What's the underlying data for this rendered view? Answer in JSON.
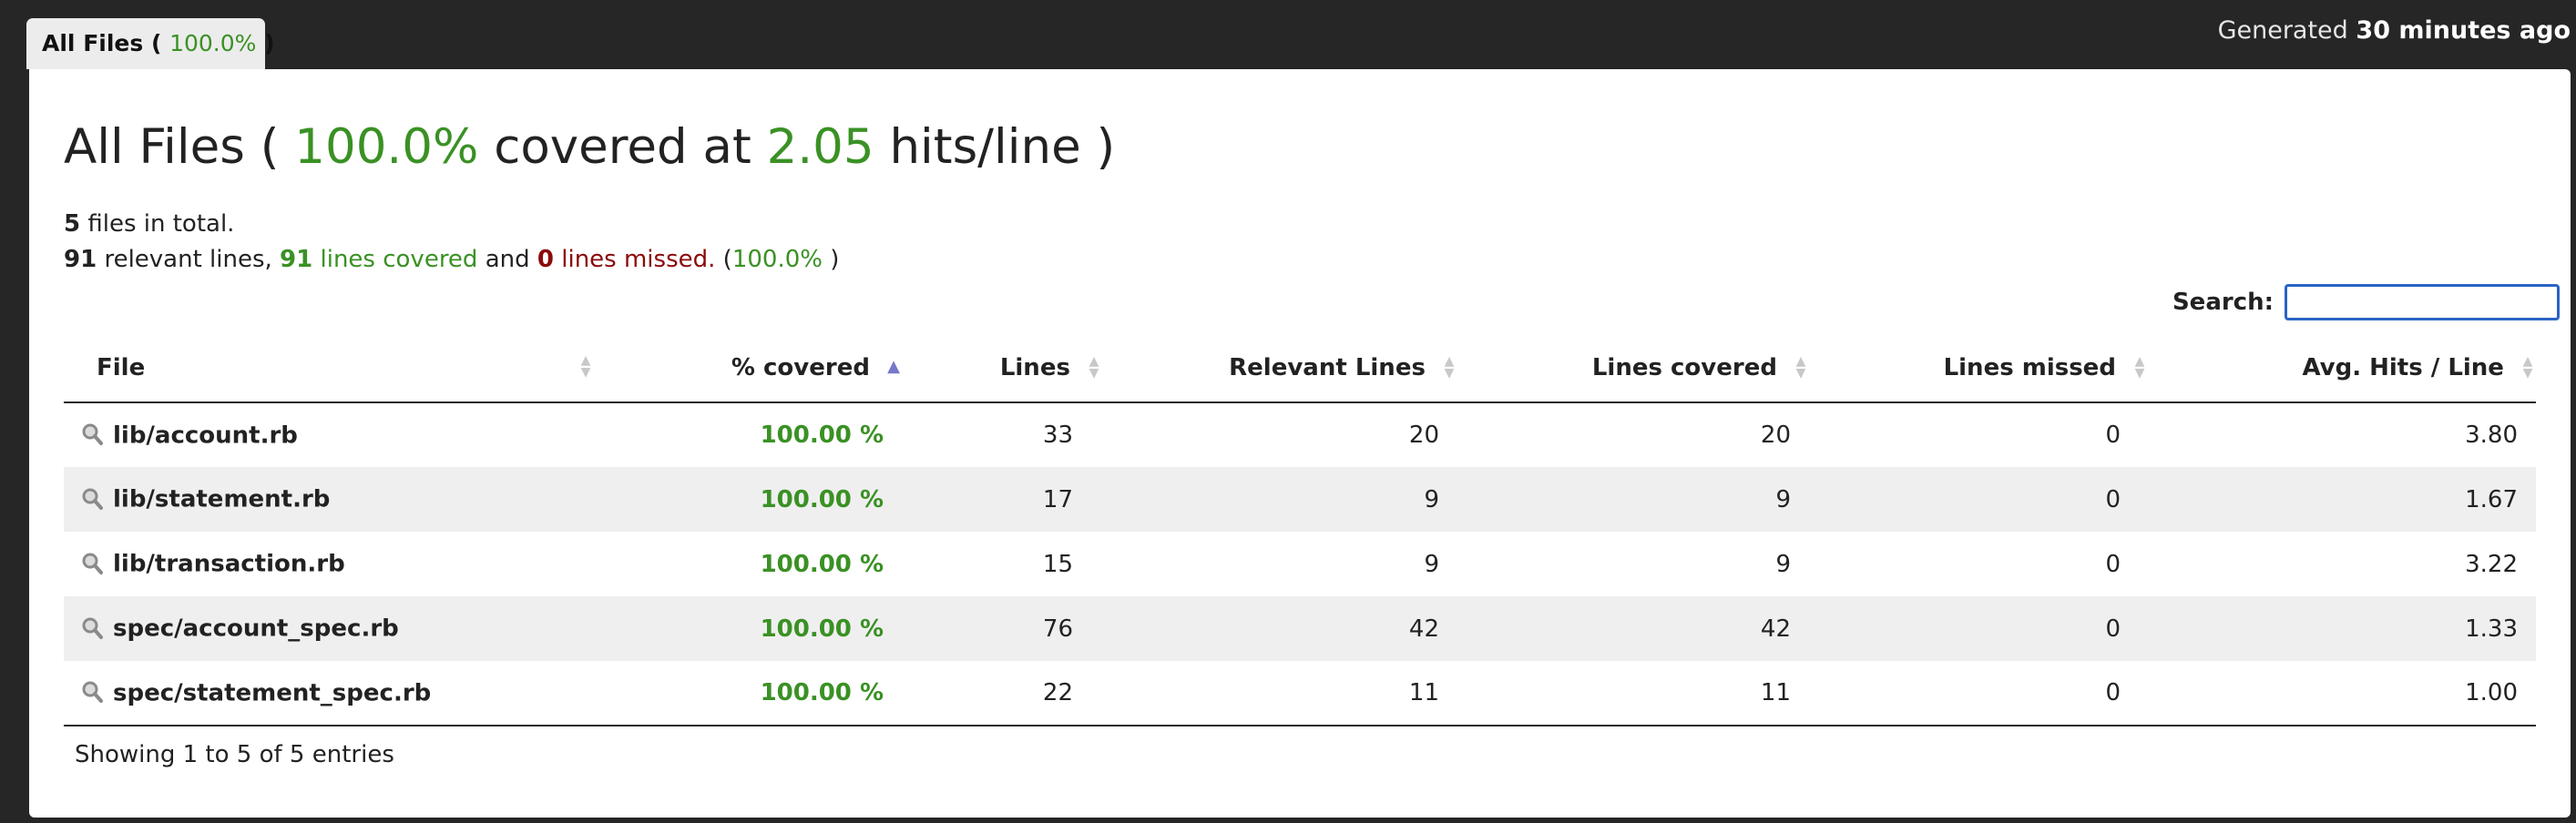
{
  "tab": {
    "label": "All Files (",
    "percent": "100.0%",
    "close": ")"
  },
  "generated": {
    "prefix": "Generated",
    "time": "30 minutes ago"
  },
  "header": {
    "title_prefix": "All Files (",
    "percent": "100.0%",
    "middle": "covered at",
    "hits": "2.05",
    "suffix": "hits/line )"
  },
  "summary": {
    "files_count": "5",
    "files_text": "files in total.",
    "relevant": "91",
    "relevant_text": "relevant lines,",
    "covered": "91",
    "covered_text": "lines covered",
    "and_text": "and",
    "missed": "0",
    "missed_text": "lines missed.",
    "open_paren": "(",
    "percent": "100.0%",
    "close_paren": ")"
  },
  "search": {
    "label": "Search:",
    "value": "",
    "placeholder": ""
  },
  "colors": {
    "covered_green": "#3a9124",
    "missed_red": "#8b0a0a",
    "search_border": "#2a64c5"
  },
  "table": {
    "columns": [
      "File",
      "% covered",
      "Lines",
      "Relevant Lines",
      "Lines covered",
      "Lines missed",
      "Avg. Hits / Line"
    ],
    "sorted_column": "% covered",
    "rows": [
      {
        "file": "lib/account.rb",
        "covered_pct": "100.00 %",
        "lines": "33",
        "relevant": "20",
        "lines_covered": "20",
        "missed": "0",
        "avg_hits": "3.80"
      },
      {
        "file": "lib/statement.rb",
        "covered_pct": "100.00 %",
        "lines": "17",
        "relevant": "9",
        "lines_covered": "9",
        "missed": "0",
        "avg_hits": "1.67"
      },
      {
        "file": "lib/transaction.rb",
        "covered_pct": "100.00 %",
        "lines": "15",
        "relevant": "9",
        "lines_covered": "9",
        "missed": "0",
        "avg_hits": "3.22"
      },
      {
        "file": "spec/account_spec.rb",
        "covered_pct": "100.00 %",
        "lines": "76",
        "relevant": "42",
        "lines_covered": "42",
        "missed": "0",
        "avg_hits": "1.33"
      },
      {
        "file": "spec/statement_spec.rb",
        "covered_pct": "100.00 %",
        "lines": "22",
        "relevant": "11",
        "lines_covered": "11",
        "missed": "0",
        "avg_hits": "1.00"
      }
    ]
  },
  "footer": {
    "info": "Showing 1 to 5 of 5 entries"
  }
}
